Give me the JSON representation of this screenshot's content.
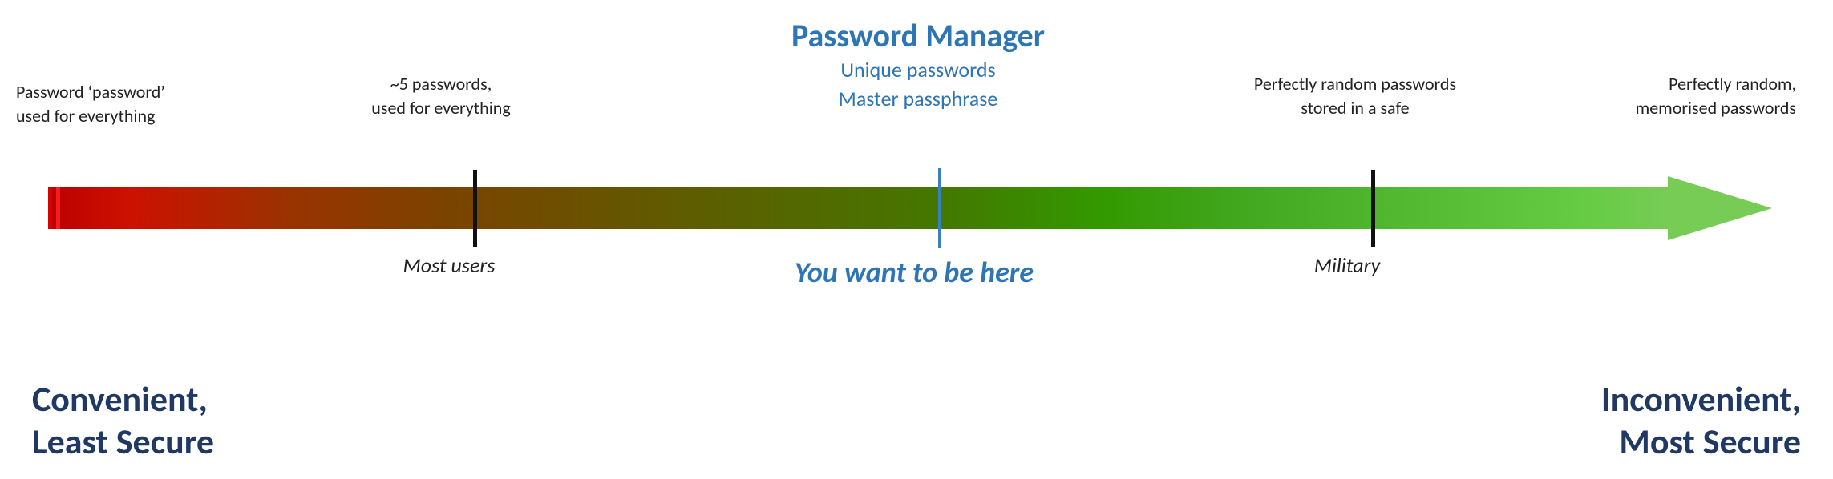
{
  "labels": {
    "password_manager_title": "Password Manager",
    "unique_passwords": "Unique passwords",
    "master_passphrase": "Master passphrase",
    "you_want_to_be_here": "You want to be here",
    "most_users": "Most users",
    "military": "Military",
    "bottom_left_line1": "Convenient,",
    "bottom_left_line2": "Least Secure",
    "bottom_right_line1": "Inconvenient,",
    "bottom_right_line2": "Most Secure",
    "label1_line1": "Password ‘password’",
    "label1_line2": "used for everything",
    "label2_line1": "~5 passwords,",
    "label2_line2": "used for everything",
    "label4_line1": "Perfectly random passwords",
    "label4_line2": "stored in a safe",
    "label5_line1": "Perfectly random,",
    "label5_line2": "memorised passwords"
  },
  "colors": {
    "blue_accent": "#2e75b6",
    "dark_navy": "#1f3864",
    "arrow_start": "#bb0000",
    "arrow_end": "#77cc55",
    "tick_color": "#111111",
    "center_marker": "#3a7fc1"
  }
}
